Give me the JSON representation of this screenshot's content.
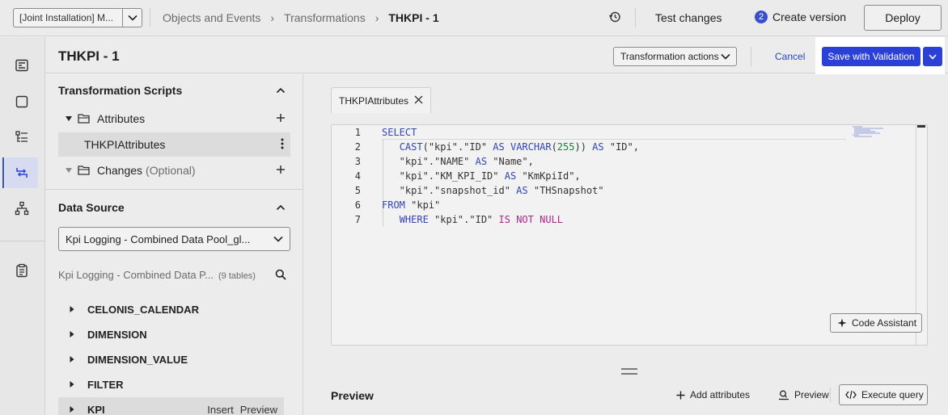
{
  "topbar": {
    "package_label": "[Joint Installation] M...",
    "breadcrumbs": [
      "Objects and Events",
      "Transformations",
      "THKPI - 1"
    ],
    "test_changes": "Test changes",
    "version_count": "2",
    "create_version": "Create version",
    "deploy": "Deploy"
  },
  "header": {
    "title": "THKPI - 1",
    "transformation_actions": "Transformation actions",
    "cancel": "Cancel",
    "save_with_validation": "Save with Validation"
  },
  "scripts": {
    "title": "Transformation Scripts",
    "items": [
      {
        "label": "Attributes"
      },
      {
        "label": "THKPIAttributes"
      },
      {
        "label": "Changes",
        "suffix": "(Optional)"
      }
    ]
  },
  "data_source": {
    "title": "Data Source",
    "selected": "Kpi Logging - Combined Data Pool_gl...",
    "info": "Kpi Logging - Combined Data P...",
    "table_count": "(9 tables)",
    "tables": [
      "CELONIS_CALENDAR",
      "DIMENSION",
      "DIMENSION_VALUE",
      "FILTER",
      "KPI"
    ],
    "row_actions": {
      "insert": "Insert",
      "preview": "Preview"
    }
  },
  "editor": {
    "tab_label": "THKPIAttributes",
    "line_numbers": [
      "1",
      "2",
      "3",
      "4",
      "5",
      "6",
      "7"
    ],
    "code_assistant": "Code Assistant"
  },
  "preview": {
    "title": "Preview",
    "add_attributes": "Add attributes",
    "preview": "Preview",
    "execute_query": "Execute query"
  },
  "colors": {
    "primary": "#2a40d8",
    "keyword": "#3344b8",
    "number": "#0a8a3a",
    "operator_keyword": "#b0248c"
  }
}
